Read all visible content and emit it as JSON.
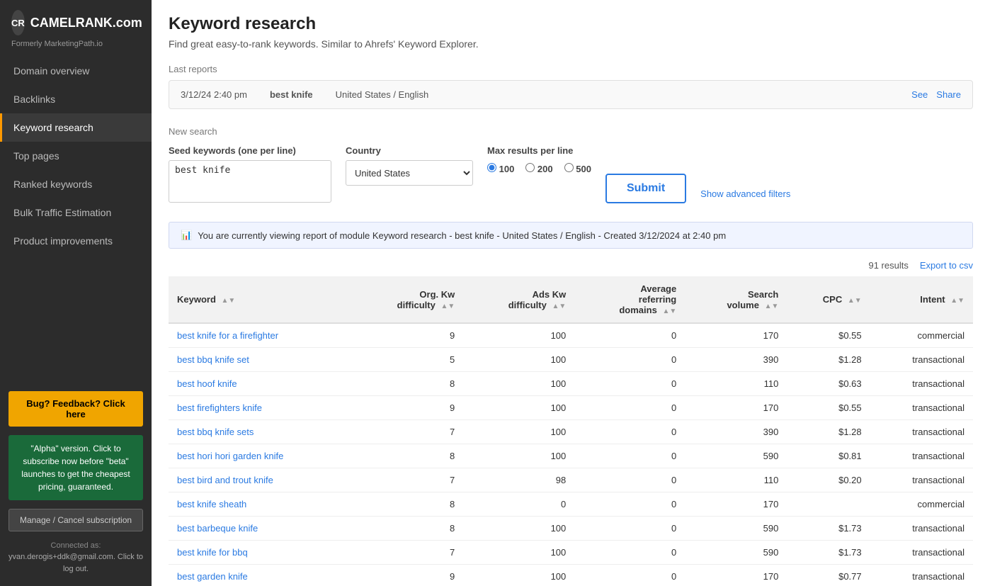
{
  "sidebar": {
    "logo_text": "CAMELRANK.com",
    "formerly": "Formerly MarketingPath.io",
    "nav_items": [
      {
        "label": "Domain overview",
        "id": "domain-overview",
        "active": false
      },
      {
        "label": "Backlinks",
        "id": "backlinks",
        "active": false
      },
      {
        "label": "Keyword research",
        "id": "keyword-research",
        "active": true
      },
      {
        "label": "Top pages",
        "id": "top-pages",
        "active": false
      },
      {
        "label": "Ranked keywords",
        "id": "ranked-keywords",
        "active": false
      },
      {
        "label": "Bulk Traffic Estimation",
        "id": "bulk-traffic",
        "active": false
      },
      {
        "label": "Product improvements",
        "id": "product-improvements",
        "active": false
      }
    ],
    "bug_button": "Bug? Feedback? Click here",
    "alpha_box": "\"Alpha\" version. Click to subscribe now before \"beta\" launches to get the cheapest pricing, guaranteed.",
    "manage_button": "Manage / Cancel subscription",
    "connected_label": "Connected as:",
    "connected_email": "yvan.derogis+ddk@gmail.com. Click to log out."
  },
  "header": {
    "title": "Keyword research",
    "subtitle": "Find great easy-to-rank keywords. Similar to Ahrefs' Keyword Explorer."
  },
  "last_reports": {
    "label": "Last reports",
    "date": "3/12/24 2:40 pm",
    "keyword": "best knife",
    "location": "United States / English",
    "see_label": "See",
    "share_label": "Share"
  },
  "new_search": {
    "label": "New search",
    "seed_keywords_label": "Seed keywords (one per line)",
    "seed_keywords_value": "best knife",
    "country_label": "Country",
    "country_value": "United States",
    "max_results_label": "Max results per line",
    "max_results_options": [
      "100",
      "200",
      "500"
    ],
    "max_results_selected": "100",
    "submit_label": "Submit",
    "show_advanced_filters": "Show advanced filters"
  },
  "report_banner": {
    "icon": "📊",
    "text": "You are currently viewing report of module Keyword research - best knife  - United States / English - Created 3/12/2024 at 2:40 pm"
  },
  "results": {
    "count": "91 results",
    "export_label": "Export to csv",
    "columns": [
      "Keyword",
      "Org. Kw difficulty",
      "Ads Kw difficulty",
      "Average referring domains",
      "Search volume",
      "CPC",
      "Intent"
    ],
    "rows": [
      {
        "keyword": "best knife for a firefighter",
        "org_kw": 9,
        "ads_kw": 100,
        "avg_ref": 0,
        "search_vol": 170,
        "cpc": "$0.55",
        "intent": "commercial"
      },
      {
        "keyword": "best bbq knife set",
        "org_kw": 5,
        "ads_kw": 100,
        "avg_ref": 0,
        "search_vol": 390,
        "cpc": "$1.28",
        "intent": "transactional"
      },
      {
        "keyword": "best hoof knife",
        "org_kw": 8,
        "ads_kw": 100,
        "avg_ref": 0,
        "search_vol": 110,
        "cpc": "$0.63",
        "intent": "transactional"
      },
      {
        "keyword": "best firefighters knife",
        "org_kw": 9,
        "ads_kw": 100,
        "avg_ref": 0,
        "search_vol": 170,
        "cpc": "$0.55",
        "intent": "transactional"
      },
      {
        "keyword": "best bbq knife sets",
        "org_kw": 7,
        "ads_kw": 100,
        "avg_ref": 0,
        "search_vol": 390,
        "cpc": "$1.28",
        "intent": "transactional"
      },
      {
        "keyword": "best hori hori garden knife",
        "org_kw": 8,
        "ads_kw": 100,
        "avg_ref": 0,
        "search_vol": 590,
        "cpc": "$0.81",
        "intent": "transactional"
      },
      {
        "keyword": "best bird and trout knife",
        "org_kw": 7,
        "ads_kw": 98,
        "avg_ref": 0,
        "search_vol": 110,
        "cpc": "$0.20",
        "intent": "transactional"
      },
      {
        "keyword": "best knife sheath",
        "org_kw": 8,
        "ads_kw": 0,
        "avg_ref": 0,
        "search_vol": 170,
        "cpc": "",
        "intent": "commercial"
      },
      {
        "keyword": "best barbeque knife",
        "org_kw": 8,
        "ads_kw": 100,
        "avg_ref": 0,
        "search_vol": 590,
        "cpc": "$1.73",
        "intent": "transactional"
      },
      {
        "keyword": "best knife for bbq",
        "org_kw": 7,
        "ads_kw": 100,
        "avg_ref": 0,
        "search_vol": 590,
        "cpc": "$1.73",
        "intent": "transactional"
      },
      {
        "keyword": "best garden knife",
        "org_kw": 9,
        "ads_kw": 100,
        "avg_ref": 0,
        "search_vol": 170,
        "cpc": "$0.77",
        "intent": "transactional"
      }
    ]
  }
}
